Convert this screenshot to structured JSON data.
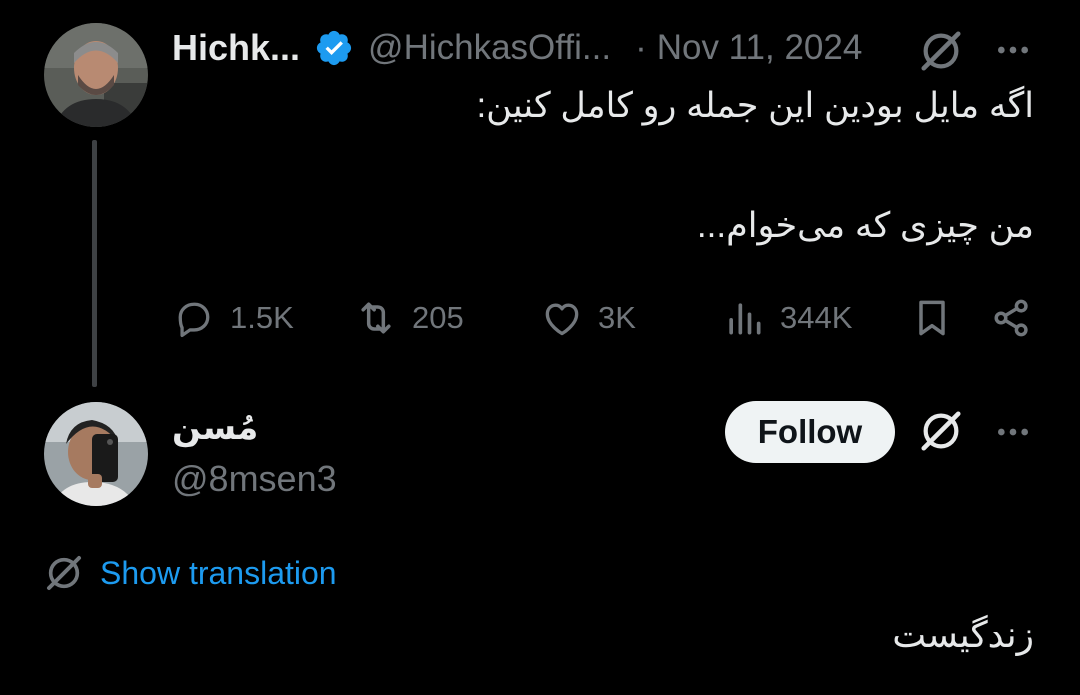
{
  "tweet": {
    "author_name": "Hichk...",
    "author_handle": "@HichkasOffi...",
    "separator": "·",
    "date": "Nov 11, 2024",
    "text_line1": "اگه مایل بودین این جمله رو کامل کنین:",
    "text_line2": "من چیزی که می‌خوام...",
    "stats": {
      "replies": "1.5K",
      "reposts": "205",
      "likes": "3K",
      "views": "344K"
    }
  },
  "reply": {
    "author_name": "مُسن",
    "author_handle": "@8msen3",
    "follow_label": "Follow",
    "translate_label": "Show translation",
    "text": "زندگیست"
  },
  "colors": {
    "background": "#000000",
    "primary_text": "#e7e9ea",
    "secondary_text": "#71767b",
    "accent": "#1d9bf0",
    "follow_bg": "#eff3f4"
  },
  "icons": [
    "verified-badge-icon",
    "grok-icon",
    "more-icon",
    "reply-icon",
    "repost-icon",
    "like-icon",
    "views-icon",
    "bookmark-icon",
    "share-icon",
    "translate-icon"
  ]
}
